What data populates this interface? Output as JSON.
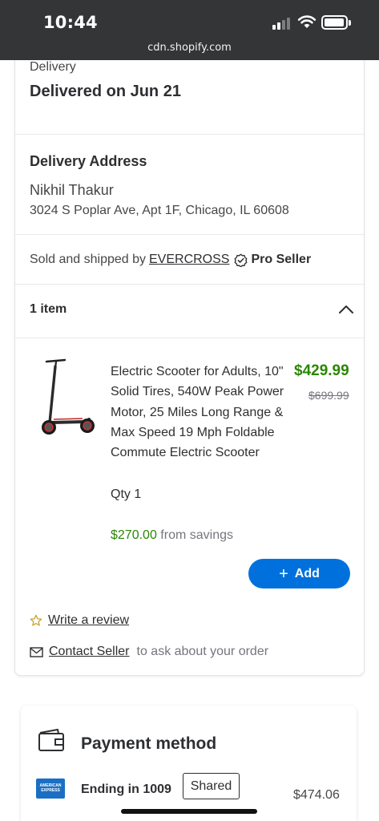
{
  "status_bar": {
    "time": "10:44",
    "url": "cdn.shopify.com"
  },
  "delivery": {
    "label": "Delivery",
    "status": "Delivered on Jun 21"
  },
  "address": {
    "heading": "Delivery Address",
    "name": "Nikhil Thakur",
    "line": "3024 S Poplar Ave, Apt 1F, Chicago, IL 60608"
  },
  "seller": {
    "prefix": "Sold and shipped by",
    "name": "EVERCROSS",
    "badge": "Pro Seller"
  },
  "items": {
    "count_label": "1 item"
  },
  "product": {
    "title": "Electric Scooter for Adults, 10\" Solid Tires, 540W Peak Power Motor, 25 Miles Long Range & Max Speed 19 Mph Foldable Commute Electric Scooter",
    "qty": "Qty 1",
    "price": "$429.99",
    "was_price": "$699.99",
    "savings_amount": "$270.00",
    "savings_suffix": "from savings",
    "add_label": "Add"
  },
  "actions": {
    "review": "Write a review",
    "contact": "Contact Seller",
    "contact_suffix": "to ask about your order"
  },
  "payment": {
    "title": "Payment method",
    "card_logo_text": "AMERICAN EXPRESS",
    "ending": "Ending in 1009",
    "shared": "Shared",
    "amount": "$474.06"
  },
  "colors": {
    "accent_blue": "#0071dc",
    "price_green": "#2a8703",
    "status_bar": "#333537"
  },
  "icons": [
    "signal-icon",
    "wifi-icon",
    "battery-icon",
    "verified-check-icon",
    "chevron-up-icon",
    "star-icon",
    "mail-icon",
    "wallet-icon",
    "amex-card-icon"
  ]
}
